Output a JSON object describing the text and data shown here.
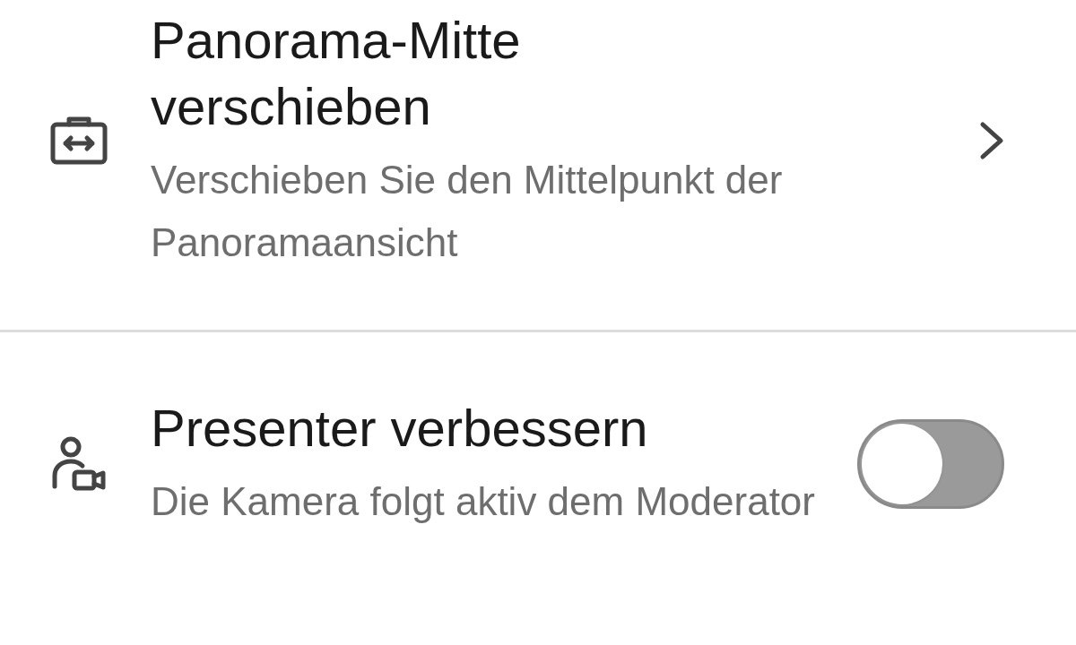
{
  "settings": [
    {
      "kind": "link",
      "title": "Panorama-Mitte verschieben",
      "description": "Verschieben Sie den Mittelpunkt der Panoramaansicht"
    },
    {
      "kind": "toggle",
      "title": "Presenter verbessern",
      "description": "Die Kamera folgt aktiv dem Moderator",
      "on": false
    }
  ]
}
